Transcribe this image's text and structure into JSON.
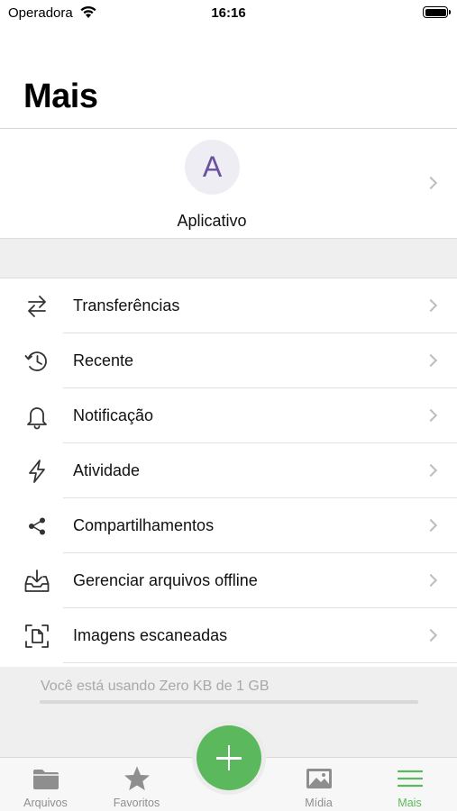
{
  "status_bar": {
    "carrier": "Operadora",
    "time": "16:16"
  },
  "header": {
    "title": "Mais"
  },
  "account": {
    "avatar_letter": "A",
    "name": "Aplicativo"
  },
  "menu": [
    {
      "label": "Transferências",
      "icon": "transfer-arrows-icon"
    },
    {
      "label": "Recente",
      "icon": "history-icon"
    },
    {
      "label": "Notificação",
      "icon": "bell-icon"
    },
    {
      "label": "Atividade",
      "icon": "lightning-icon"
    },
    {
      "label": "Compartilhamentos",
      "icon": "share-icon"
    },
    {
      "label": "Gerenciar arquivos offline",
      "icon": "download-tray-icon"
    },
    {
      "label": "Imagens escaneadas",
      "icon": "scanned-document-icon"
    }
  ],
  "storage": {
    "text": "Você está usando Zero KB de 1 GB",
    "used_fraction": 0
  },
  "tabbar": {
    "tabs": [
      {
        "label": "Arquivos",
        "icon": "folder-icon"
      },
      {
        "label": "Favoritos",
        "icon": "star-icon"
      },
      {
        "label": "Mídia",
        "icon": "image-icon"
      },
      {
        "label": "Mais",
        "icon": "menu-lines-icon",
        "active": true
      }
    ],
    "add_button_icon": "plus-icon"
  },
  "colors": {
    "accent": "#5cb85c",
    "avatar_letter": "#6b4fa3",
    "background_gray": "#efefef"
  }
}
